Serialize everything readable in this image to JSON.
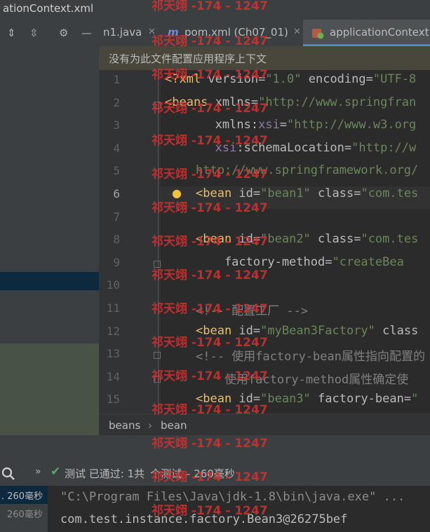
{
  "window": {
    "title": "ationContext.xml"
  },
  "left_toolbar": {
    "icons": [
      "expand-all-icon",
      "collapse-all-icon",
      "gear-icon",
      "minimize-icon"
    ]
  },
  "tabs": [
    {
      "label": "n1.java",
      "icon": "java-file-icon",
      "active": false
    },
    {
      "label": "pom.xml (Ch07_01)",
      "icon": "maven-icon",
      "active": false
    },
    {
      "label": "applicationContext",
      "icon": "spring-xml-icon",
      "active": true
    }
  ],
  "notice": {
    "text": "没有为此文件配置应用程序上下文"
  },
  "editor": {
    "current_line": 6,
    "lines": [
      {
        "n": "1",
        "tokens": [
          [
            "t",
            "<?xml "
          ],
          [
            "a",
            "version="
          ],
          [
            "v",
            "\"1.0\" "
          ],
          [
            "a",
            "encoding="
          ],
          [
            "v",
            "\"UTF-8"
          ]
        ]
      },
      {
        "n": "2",
        "tokens": [
          [
            "t",
            "<beans "
          ],
          [
            "a",
            "xmlns="
          ],
          [
            "v",
            "\"http://www.springfran"
          ]
        ]
      },
      {
        "n": "3",
        "tokens": [
          [
            "a",
            "       "
          ],
          [
            "a",
            "xmlns:"
          ],
          [
            "ns",
            "xsi"
          ],
          [
            "a",
            "="
          ],
          [
            "v",
            "\"http://www.w3.org"
          ]
        ]
      },
      {
        "n": "4",
        "tokens": [
          [
            "a",
            "       "
          ],
          [
            "ns",
            "xsi"
          ],
          [
            "a",
            ":schemaLocation="
          ],
          [
            "v",
            "\"http://w"
          ]
        ]
      },
      {
        "n": "5",
        "tokens": [
          [
            "v",
            "http://www.springframework.org/"
          ]
        ]
      },
      {
        "n": "6",
        "tokens": [
          [
            "t",
            "<bean "
          ],
          [
            "a",
            "id="
          ],
          [
            "v",
            "\"bean1\" "
          ],
          [
            "a",
            "class="
          ],
          [
            "v",
            "\"com.tes"
          ]
        ]
      },
      {
        "n": "7",
        "tokens": []
      },
      {
        "n": "8",
        "tokens": [
          [
            "t",
            "<bean "
          ],
          [
            "a",
            "id="
          ],
          [
            "v",
            "\"bean2\" "
          ],
          [
            "a",
            "class="
          ],
          [
            "v",
            "\"com.tes"
          ]
        ]
      },
      {
        "n": "9",
        "tokens": [
          [
            "a",
            "    factory-method="
          ],
          [
            "v",
            "\"createBea"
          ]
        ]
      },
      {
        "n": "10",
        "tokens": []
      },
      {
        "n": "11",
        "tokens": [
          [
            "c",
            "<!-- 配置工厂 -->"
          ]
        ]
      },
      {
        "n": "12",
        "tokens": [
          [
            "t",
            "<bean "
          ],
          [
            "a",
            "id="
          ],
          [
            "v",
            "\"myBean3Factory\" "
          ],
          [
            "a",
            "class"
          ]
        ]
      },
      {
        "n": "13",
        "tokens": [
          [
            "c",
            "<!-- 使用factory-bean属性指向配置的"
          ]
        ]
      },
      {
        "n": "14",
        "tokens": [
          [
            "c",
            "    使用factory-method属性确定使"
          ]
        ]
      },
      {
        "n": "15",
        "tokens": [
          [
            "t",
            "<bean "
          ],
          [
            "a",
            "id="
          ],
          [
            "v",
            "\"bean3\" "
          ],
          [
            "a",
            "factory-bean="
          ],
          [
            "v",
            "\""
          ]
        ]
      }
    ]
  },
  "breadcrumb": [
    "beans",
    "bean"
  ],
  "run": {
    "status_prefix": "测试 已通过: 1共",
    "status_suffix": "个测试 – 260毫秒",
    "left_times": [
      ". 260毫秒",
      "260毫秒"
    ],
    "console": [
      "\"C:\\Program Files\\Java\\jdk-1.8\\bin\\java.exe\" ...",
      "com.test.instance.factory.Bean3@26275bef"
    ]
  },
  "watermark": "祁天翊 -174 - 1247",
  "colors": {
    "tag": "#e8bf6a",
    "attr_value": "#6a8759",
    "namespace": "#9876aa",
    "comment": "#808080",
    "pass": "#59a869",
    "watermark": "#d63030"
  }
}
